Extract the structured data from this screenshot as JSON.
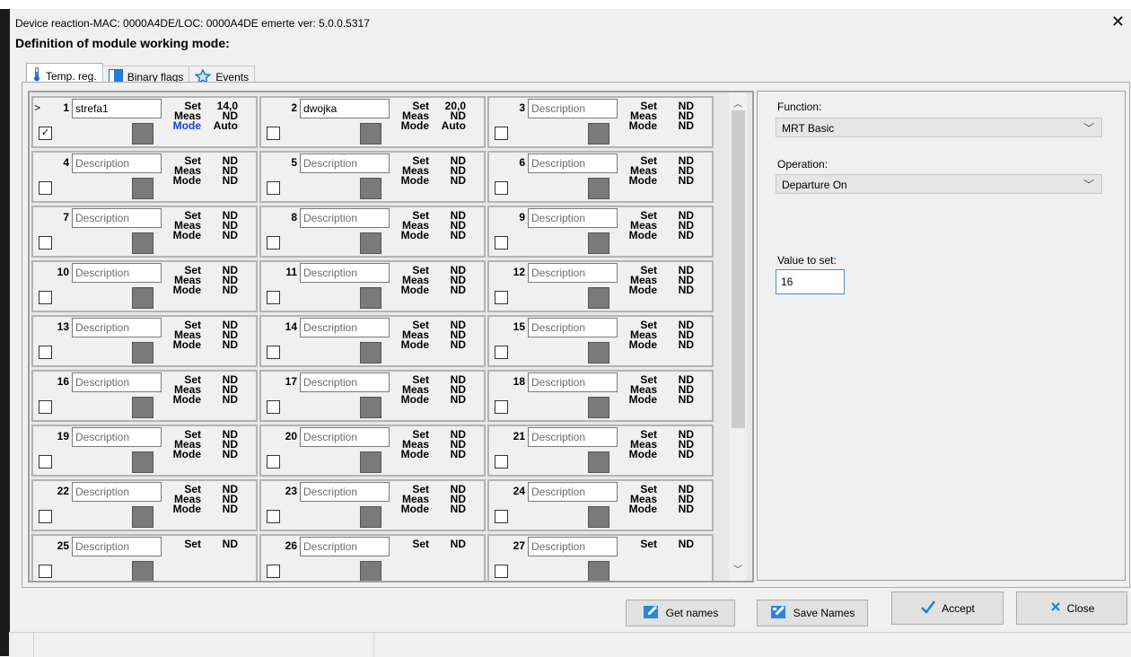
{
  "window": {
    "title": "Device reaction-MAC: 0000A4DE/LOC: 0000A4DE emerte ver: 5.0.0.5317",
    "heading": "Definition of module working mode:"
  },
  "tabs": [
    {
      "label": "Temp. reg.",
      "icon": "thermometer-icon",
      "active": true
    },
    {
      "label": "Binary flags",
      "icon": "binary-flag-icon",
      "active": false
    },
    {
      "label": "Events",
      "icon": "star-icon",
      "active": false
    }
  ],
  "labels": {
    "set": "Set",
    "meas": "Meas",
    "mode": "Mode",
    "placeholder": "Description"
  },
  "zones": [
    {
      "num": "1",
      "name": "strefa1",
      "checked": true,
      "set": "14,0",
      "meas": "ND",
      "mode": "Auto",
      "selected": true
    },
    {
      "num": "2",
      "name": "dwojka",
      "checked": false,
      "set": "20,0",
      "meas": "ND",
      "mode": "Auto"
    },
    {
      "num": "3",
      "name": "",
      "checked": false,
      "set": "ND",
      "meas": "ND",
      "mode": "ND"
    },
    {
      "num": "4",
      "name": "",
      "checked": false,
      "set": "ND",
      "meas": "ND",
      "mode": "ND"
    },
    {
      "num": "5",
      "name": "",
      "checked": false,
      "set": "ND",
      "meas": "ND",
      "mode": "ND"
    },
    {
      "num": "6",
      "name": "",
      "checked": false,
      "set": "ND",
      "meas": "ND",
      "mode": "ND"
    },
    {
      "num": "7",
      "name": "",
      "checked": false,
      "set": "ND",
      "meas": "ND",
      "mode": "ND"
    },
    {
      "num": "8",
      "name": "",
      "checked": false,
      "set": "ND",
      "meas": "ND",
      "mode": "ND"
    },
    {
      "num": "9",
      "name": "",
      "checked": false,
      "set": "ND",
      "meas": "ND",
      "mode": "ND"
    },
    {
      "num": "10",
      "name": "",
      "checked": false,
      "set": "ND",
      "meas": "ND",
      "mode": "ND"
    },
    {
      "num": "11",
      "name": "",
      "checked": false,
      "set": "ND",
      "meas": "ND",
      "mode": "ND"
    },
    {
      "num": "12",
      "name": "",
      "checked": false,
      "set": "ND",
      "meas": "ND",
      "mode": "ND"
    },
    {
      "num": "13",
      "name": "",
      "checked": false,
      "set": "ND",
      "meas": "ND",
      "mode": "ND"
    },
    {
      "num": "14",
      "name": "",
      "checked": false,
      "set": "ND",
      "meas": "ND",
      "mode": "ND"
    },
    {
      "num": "15",
      "name": "",
      "checked": false,
      "set": "ND",
      "meas": "ND",
      "mode": "ND"
    },
    {
      "num": "16",
      "name": "",
      "checked": false,
      "set": "ND",
      "meas": "ND",
      "mode": "ND"
    },
    {
      "num": "17",
      "name": "",
      "checked": false,
      "set": "ND",
      "meas": "ND",
      "mode": "ND"
    },
    {
      "num": "18",
      "name": "",
      "checked": false,
      "set": "ND",
      "meas": "ND",
      "mode": "ND"
    },
    {
      "num": "19",
      "name": "",
      "checked": false,
      "set": "ND",
      "meas": "ND",
      "mode": "ND"
    },
    {
      "num": "20",
      "name": "",
      "checked": false,
      "set": "ND",
      "meas": "ND",
      "mode": "ND"
    },
    {
      "num": "21",
      "name": "",
      "checked": false,
      "set": "ND",
      "meas": "ND",
      "mode": "ND"
    },
    {
      "num": "22",
      "name": "",
      "checked": false,
      "set": "ND",
      "meas": "ND",
      "mode": "ND"
    },
    {
      "num": "23",
      "name": "",
      "checked": false,
      "set": "ND",
      "meas": "ND",
      "mode": "ND"
    },
    {
      "num": "24",
      "name": "",
      "checked": false,
      "set": "ND",
      "meas": "ND",
      "mode": "ND"
    },
    {
      "num": "25",
      "name": "",
      "checked": false,
      "set": "ND",
      "meas": "",
      "mode": ""
    },
    {
      "num": "26",
      "name": "",
      "checked": false,
      "set": "ND",
      "meas": "",
      "mode": ""
    },
    {
      "num": "27",
      "name": "",
      "checked": false,
      "set": "ND",
      "meas": "",
      "mode": ""
    }
  ],
  "side": {
    "function_label": "Function:",
    "function_value": "MRT Basic",
    "operation_label": "Operation:",
    "operation_value": "Departure On",
    "value_label": "Value to set:",
    "value": "16"
  },
  "buttons": {
    "get_names": "Get names",
    "save_names": "Save Names",
    "accept": "Accept",
    "close": "Close"
  },
  "colors": {
    "mode_accent": "#1a3cd6",
    "accept_icon": "#1e7fd6",
    "close_icon": "#1e7fd6"
  }
}
